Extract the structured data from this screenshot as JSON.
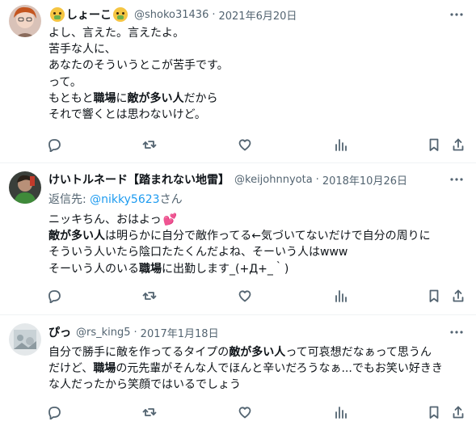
{
  "tweets": [
    {
      "name": "しょーこ",
      "handle": "@shoko31436",
      "dot": "·",
      "date": "2021年6月20日",
      "lines": [
        [
          {
            "t": "よし、言えた。言えたよ。",
            "b": false
          }
        ],
        [
          {
            "t": "苦手な人に、",
            "b": false
          }
        ],
        [
          {
            "t": "あなたのそういうとこが苦手です。",
            "b": false
          }
        ],
        [
          {
            "t": "って。",
            "b": false
          }
        ],
        [
          {
            "t": "もともと",
            "b": false
          },
          {
            "t": "職場",
            "b": true
          },
          {
            "t": "に",
            "b": false
          },
          {
            "t": "敵が多い人",
            "b": true
          },
          {
            "t": "だから",
            "b": false
          }
        ],
        [
          {
            "t": "それで響くとは思わないけど。",
            "b": false
          }
        ]
      ]
    },
    {
      "name": "けいトルネード【踏まれない地雷】",
      "handle": "@keijohnnyota",
      "dot": "·",
      "date": "2018年10月26日",
      "reply_prefix": "返信先: ",
      "reply_mention": "@nikky5623",
      "reply_suffix": "さん",
      "lines": [
        [
          {
            "t": "ニッキちん、おはよっ",
            "b": false
          }
        ],
        [
          {
            "t": "敵が多い人",
            "b": true
          },
          {
            "t": "は明らかに自分で敵作ってる←気づいてないだけで自分の周りに",
            "b": false
          }
        ],
        [
          {
            "t": "そういう人いたら陰口たたくんだよね、そーいう人はwww",
            "b": false
          }
        ],
        [
          {
            "t": "そーいう人のいる",
            "b": false
          },
          {
            "t": "職場",
            "b": true
          },
          {
            "t": "に出勤します_(+Д+_｀)",
            "b": false
          }
        ]
      ]
    },
    {
      "name": "ぴっ",
      "handle": "@rs_king5",
      "dot": "·",
      "date": "2017年1月18日",
      "lines": [
        [
          {
            "t": "自分で勝手に敵を作ってるタイプの",
            "b": false
          },
          {
            "t": "敵が多い人",
            "b": true
          },
          {
            "t": "って可哀想だなぁって思うん",
            "b": false
          }
        ],
        [
          {
            "t": "だけど、",
            "b": false
          },
          {
            "t": "職場",
            "b": true
          },
          {
            "t": "の元先輩がそんな人でほんと辛いだろうなぁ...でもお笑い好きき",
            "b": false
          }
        ],
        [
          {
            "t": "な人だったから笑顔ではいるでしょう",
            "b": false
          }
        ]
      ]
    }
  ],
  "icons": {
    "reply": "reply-icon",
    "retweet": "retweet-icon",
    "like": "heart-icon",
    "views": "views-icon",
    "bookmark": "bookmark-icon",
    "share": "share-icon",
    "more": "more-icon"
  },
  "colors": {
    "text": "#0f1419",
    "secondary": "#536471",
    "link": "#1d9bf0",
    "divider": "#eff3f4"
  }
}
